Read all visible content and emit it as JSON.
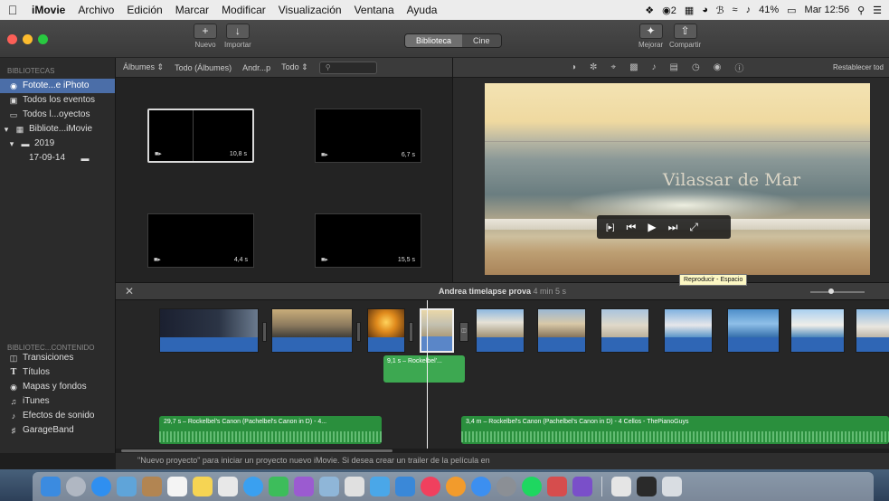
{
  "menubar": {
    "app": "iMovie",
    "items": [
      "Archivo",
      "Edición",
      "Marcar",
      "Modificar",
      "Visualización",
      "Ventana",
      "Ayuda"
    ],
    "status": {
      "battery": "41%",
      "clock": "Mar 12:56",
      "badge": "2"
    }
  },
  "toolbar": {
    "new_label": "Nuevo",
    "import_label": "Importar",
    "segment": [
      "Biblioteca",
      "Cine"
    ],
    "improve_label": "Mejorar",
    "share_label": "Compartir"
  },
  "sidebar": {
    "libraries_header": "BIBLIOTECAS",
    "items": [
      {
        "label": "Fotote...e iPhoto",
        "icon": "camera-icon",
        "selected": true
      },
      {
        "label": "Todos los eventos",
        "icon": "film-icon",
        "selected": false
      },
      {
        "label": "Todos l...oyectos",
        "icon": "project-icon",
        "selected": false
      },
      {
        "label": "Bibliote...iMovie",
        "icon": "library-icon",
        "selected": false
      },
      {
        "label": "2019",
        "icon": "folder-icon",
        "selected": false
      },
      {
        "label": "17-09-14",
        "icon": "event-icon",
        "selected": false
      }
    ],
    "content_header": "BIBLIOTEC...CONTENIDO",
    "content_items": [
      {
        "label": "Transiciones",
        "icon": "transitions-icon"
      },
      {
        "label": "Títulos",
        "icon": "titles-icon"
      },
      {
        "label": "Mapas y fondos",
        "icon": "globe-icon"
      },
      {
        "label": "iTunes",
        "icon": "music-note-icon"
      },
      {
        "label": "Efectos de sonido",
        "icon": "speaker-icon"
      },
      {
        "label": "GarageBand",
        "icon": "guitar-icon"
      }
    ]
  },
  "browser": {
    "filter_albums": "Álbumes",
    "filter_all": "Todo (Álbumes)",
    "breadcrumb": "Andr...p",
    "filter_todo": "Todo",
    "clips": [
      {
        "duration": "10,8 s",
        "selected": true
      },
      {
        "duration": "6,7 s",
        "selected": false
      },
      {
        "duration": "4,4 s",
        "selected": false
      },
      {
        "duration": "15,5 s",
        "selected": false
      }
    ]
  },
  "viewer": {
    "reset_label": "Restablecer tod",
    "title_overlay": "Vilassar de Mar",
    "tooltip": "Reproducir - Espacio"
  },
  "timeline": {
    "project_name": "Andrea timelapse prova",
    "project_duration": "4 min 5 s",
    "music_clip": "9,1 s – Rockelbel'...",
    "audio_tracks": [
      "29,7 s – Rockelbel's Canon (Pachelbel's Canon in D) - 4...",
      "3,4 m – Rockelbel's Canon (Pachelbel's Canon in D) - 4 Cellos - ThePianoGuys"
    ]
  },
  "status": {
    "text": "\"Nuevo proyecto\" para iniciar un proyecto nuevo iMovie. Si desea crear un trailer de la película en"
  },
  "colors": {
    "accent": "#4b6ea8",
    "video_bar": "#2f66b5",
    "audio": "#2a8f3d",
    "close_red": "#fc5f57",
    "min_yellow": "#fdbc2e",
    "max_green": "#28c840"
  }
}
